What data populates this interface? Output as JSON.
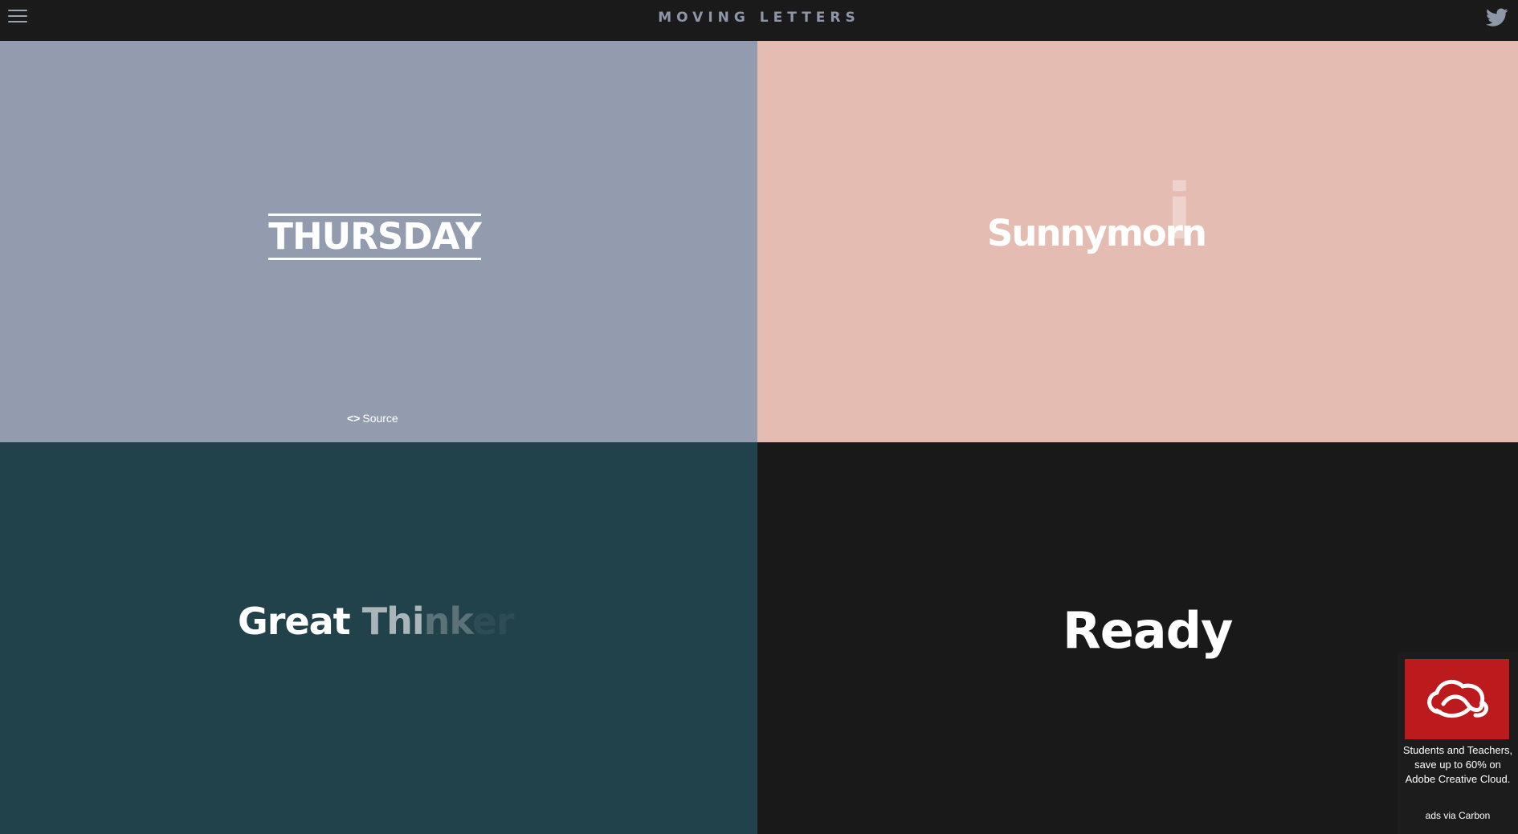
{
  "header": {
    "title": "MOVING LETTERS",
    "menu_icon": "hamburger-menu-icon",
    "social_icon": "twitter-icon"
  },
  "tiles": {
    "thursday": {
      "text": "THURSDAY",
      "background": "#929cae",
      "source_label": "Source",
      "source_icon": "code-icon"
    },
    "sunny": {
      "text": "Sunnymorn",
      "ghost_letter": "i",
      "background": "#e4bcb1"
    },
    "great_thinkers": {
      "part1": "Great ",
      "part2": "Thi",
      "part3": "nk",
      "part4": "er",
      "background": "#21414b"
    },
    "ready": {
      "text": "Ready",
      "background": "#191919"
    }
  },
  "ad": {
    "brand_icon": "adobe-creative-cloud-icon",
    "text": "Students and Teachers, save up to 60% on Adobe Creative Cloud.",
    "via": "ads via Carbon",
    "background": "#bd1a1d"
  }
}
